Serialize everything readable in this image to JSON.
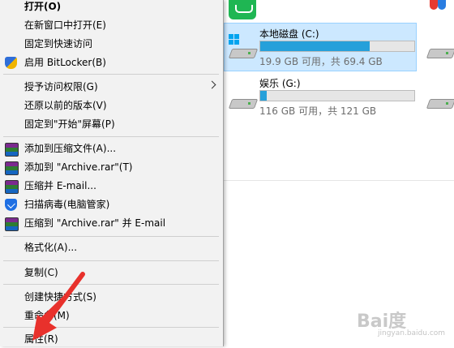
{
  "context_menu": {
    "items": [
      {
        "label": "打开(O)",
        "bold": true
      },
      {
        "label": "在新窗口中打开(E)"
      },
      {
        "label": "固定到快速访问"
      },
      {
        "label": "启用 BitLocker(B)",
        "icon": "shield-icon"
      },
      {
        "label": "授予访问权限(G)",
        "submenu": true
      },
      {
        "label": "还原以前的版本(V)"
      },
      {
        "label": "固定到\"开始\"屏幕(P)"
      },
      {
        "label": "添加到压缩文件(A)...",
        "icon": "winrar-icon"
      },
      {
        "label": "添加到 \"Archive.rar\"(T)",
        "icon": "winrar-icon"
      },
      {
        "label": "压缩并 E-mail...",
        "icon": "winrar-icon"
      },
      {
        "label": "扫描病毒(电脑管家)",
        "icon": "tencent-pc-manager-icon"
      },
      {
        "label": "压缩到 \"Archive.rar\" 并 E-mail",
        "icon": "winrar-icon"
      },
      {
        "label": "格式化(A)..."
      },
      {
        "label": "复制(C)"
      },
      {
        "label": "创建快捷方式(S)"
      },
      {
        "label": "重命名(M)"
      },
      {
        "label": "属性(R)"
      }
    ]
  },
  "drives": [
    {
      "name": "本地磁盘 (C:)",
      "usage": "19.9 GB 可用，共 69.4 GB",
      "used_fraction": 0.71,
      "selected": true
    },
    {
      "name": "娱乐 (G:)",
      "usage": "116 GB 可用，共 121 GB",
      "used_fraction": 0.04,
      "selected": false
    }
  ],
  "colors": {
    "menu_bg": "#f2f2f2",
    "selection_bg": "#cce8ff",
    "bar_fill": "#26a0da",
    "arrow": "#e8312c"
  },
  "watermark": {
    "brand": "Bai度",
    "url": "jingyan.baidu.com"
  }
}
